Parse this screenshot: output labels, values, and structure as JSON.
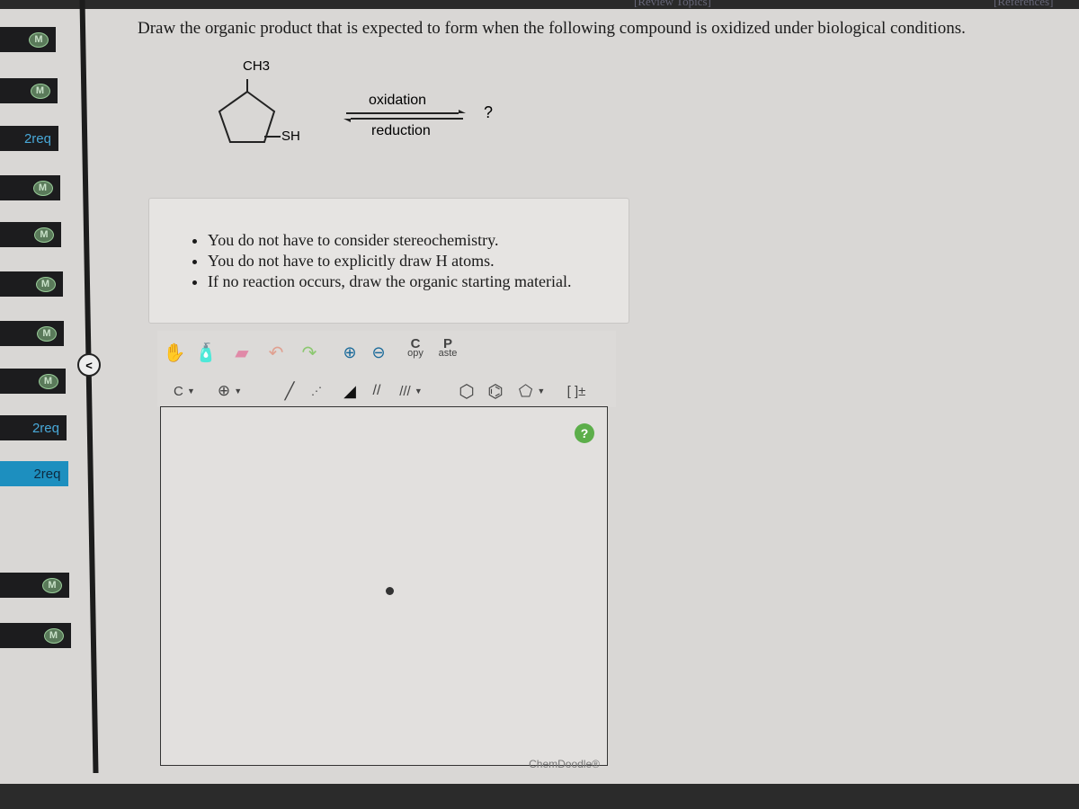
{
  "header": {
    "review_topics": "[Review Topics]",
    "references": "[References]"
  },
  "sidebar": {
    "items": [
      {
        "type": "badge",
        "label": "M"
      },
      {
        "type": "badge",
        "label": "M"
      },
      {
        "type": "text",
        "label": "2req"
      },
      {
        "type": "badge",
        "label": "M"
      },
      {
        "type": "badge",
        "label": "M"
      },
      {
        "type": "badge",
        "label": "M"
      },
      {
        "type": "badge",
        "label": "M"
      },
      {
        "type": "badge",
        "label": "M"
      },
      {
        "type": "text",
        "label": "2req"
      },
      {
        "type": "text",
        "label": "2req",
        "active": true
      },
      {
        "type": "badge",
        "label": "M"
      },
      {
        "type": "badge",
        "label": "M"
      }
    ],
    "collapse": "<"
  },
  "question": {
    "prompt": "Draw the organic product that is expected to form when the following compound is oxidized under biological conditions.",
    "reaction": {
      "substituent_top": "CH3",
      "substituent_right": "SH",
      "arrow_top": "oxidation",
      "arrow_bottom": "reduction",
      "product": "?"
    },
    "notes": [
      "You do not have to consider stereochemistry.",
      "You do not have to explicitly draw H atoms.",
      "If no reaction occurs, draw the organic starting material."
    ]
  },
  "toolbar": {
    "copy_top": "C",
    "copy_bottom": "opy",
    "paste_top": "P",
    "paste_bottom": "aste",
    "element": "C",
    "charge_bracket": "[ ]±"
  },
  "canvas": {
    "help": "?",
    "brand": "ChemDoodle®"
  }
}
